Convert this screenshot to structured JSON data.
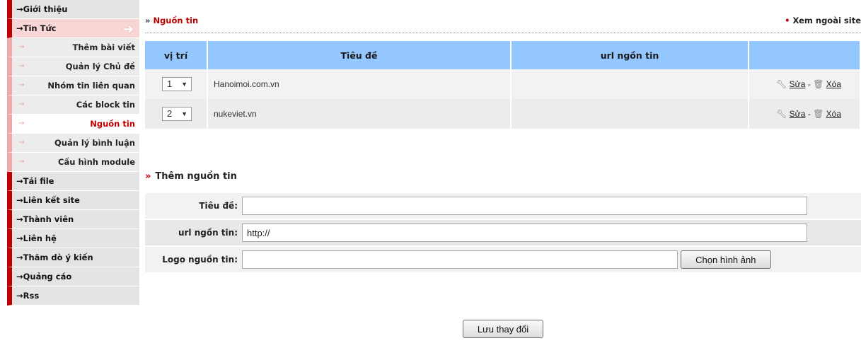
{
  "sidebar": {
    "items": [
      {
        "label": "Giới thiệu"
      },
      {
        "label": "Tin Tức"
      },
      {
        "label": "Tải file"
      },
      {
        "label": "Liên kết site"
      },
      {
        "label": "Thành viên"
      },
      {
        "label": "Liên hệ"
      },
      {
        "label": "Thăm dò ý kiến"
      },
      {
        "label": "Quảng cáo"
      },
      {
        "label": "Rss"
      }
    ],
    "sub_items": [
      {
        "label": "Thêm bài viết"
      },
      {
        "label": "Quản lý Chủ đề"
      },
      {
        "label": "Nhóm tin liên quan"
      },
      {
        "label": "Các block tin"
      },
      {
        "label": "Nguồn tin"
      },
      {
        "label": "Quản lý bình luận"
      },
      {
        "label": "Cấu hình module"
      }
    ],
    "arrow": "→"
  },
  "header": {
    "breadcrumb_prefix": "»",
    "breadcrumb": "Nguồn tin",
    "view_site_dot": "•",
    "view_site": "Xem ngoài site"
  },
  "table": {
    "columns": [
      "vị trí",
      "Tiêu đề",
      "url ngồn tin",
      ""
    ],
    "rows": [
      {
        "position": "1",
        "title": "Hanoimoi.com.vn",
        "url": "",
        "edit": "Sửa",
        "sep": "-",
        "delete": "Xóa"
      },
      {
        "position": "2",
        "title": "nukeviet.vn",
        "url": "",
        "edit": "Sửa",
        "sep": "-",
        "delete": "Xóa"
      }
    ]
  },
  "add_form": {
    "heading_prefix": "»",
    "heading": "Thêm nguồn tin",
    "title_label": "Tiêu đề:",
    "title_value": "",
    "url_label": "url ngồn tin:",
    "url_value": "http://",
    "logo_label": "Logo nguồn tin:",
    "logo_value": "",
    "choose_image": "Chọn hình ảnh",
    "save": "Lưu thay đổi"
  },
  "icons": {
    "wrench": "wrench-icon",
    "trash": "trash-icon",
    "select_caret": "chevron-down-icon"
  },
  "colors": {
    "accent_red": "#c00000",
    "header_blue": "#94c6ff"
  }
}
